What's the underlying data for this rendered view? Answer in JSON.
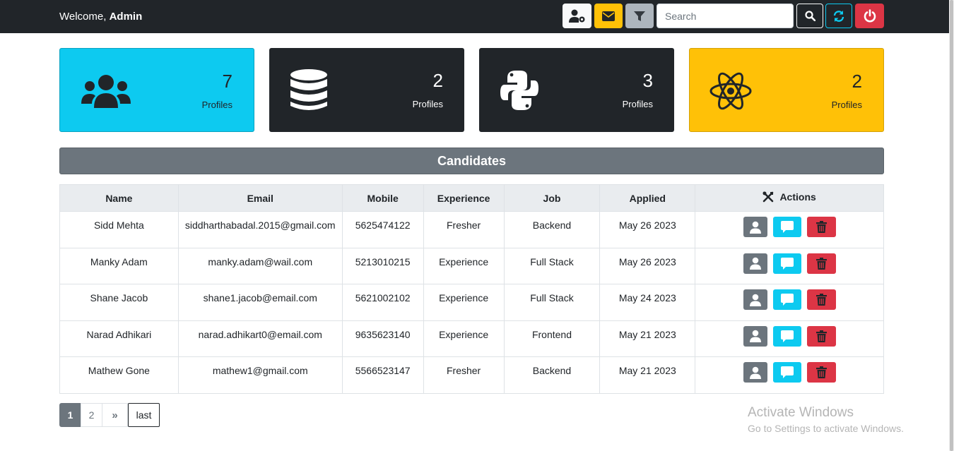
{
  "header": {
    "welcome_prefix": "Welcome,",
    "welcome_user": "Admin",
    "search_placeholder": "Search",
    "buttons": [
      {
        "name": "user-settings",
        "icon": "user-gear-icon"
      },
      {
        "name": "mail",
        "icon": "envelope-icon"
      },
      {
        "name": "filter",
        "icon": "filter-icon"
      },
      {
        "name": "search",
        "icon": "search-icon"
      },
      {
        "name": "refresh",
        "icon": "refresh-icon"
      },
      {
        "name": "logout",
        "icon": "power-icon"
      }
    ]
  },
  "cards": [
    {
      "count": "7",
      "label": "Profiles",
      "icon": "users-icon",
      "color": "#0dcaf0"
    },
    {
      "count": "2",
      "label": "Profiles",
      "icon": "database-icon",
      "color": "#212529"
    },
    {
      "count": "3",
      "label": "Profiles",
      "icon": "python-icon",
      "color": "#212529"
    },
    {
      "count": "2",
      "label": "Profiles",
      "icon": "react-icon",
      "color": "#ffc107"
    }
  ],
  "section_title": "Candidates",
  "table": {
    "columns": [
      "Name",
      "Email",
      "Mobile",
      "Experience",
      "Job",
      "Applied",
      "Actions"
    ],
    "rows": [
      {
        "name": "Sidd Mehta",
        "email": "siddharthabadal.2015@gmail.com",
        "mobile": "5625474122",
        "experience": "Fresher",
        "job": "Backend",
        "applied": "May 26 2023"
      },
      {
        "name": "Manky Adam",
        "email": "manky.adam@wail.com",
        "mobile": "5213010215",
        "experience": "Experience",
        "job": "Full Stack",
        "applied": "May 26 2023"
      },
      {
        "name": "Shane Jacob",
        "email": "shane1.jacob@email.com",
        "mobile": "5621002102",
        "experience": "Experience",
        "job": "Full Stack",
        "applied": "May 24 2023"
      },
      {
        "name": "Narad Adhikari",
        "email": "narad.adhikart0@email.com",
        "mobile": "9635623140",
        "experience": "Experience",
        "job": "Frontend",
        "applied": "May 21 2023"
      },
      {
        "name": "Mathew Gone",
        "email": "mathew1@gmail.com",
        "mobile": "5566523147",
        "experience": "Fresher",
        "job": "Backend",
        "applied": "May 21 2023"
      }
    ],
    "row_actions": [
      "profile-icon",
      "chat-icon",
      "trash-icon"
    ]
  },
  "pagination": {
    "pages": [
      "1",
      "2"
    ],
    "next_label": "»",
    "last_label": "last",
    "current": "1"
  },
  "watermark": {
    "line1": "Activate Windows",
    "line2": "Go to Settings to activate Windows."
  },
  "colors": {
    "navbar": "#212529",
    "info": "#0dcaf0",
    "warning": "#ffc107",
    "danger": "#dc3545",
    "secondary": "#6c757d"
  }
}
